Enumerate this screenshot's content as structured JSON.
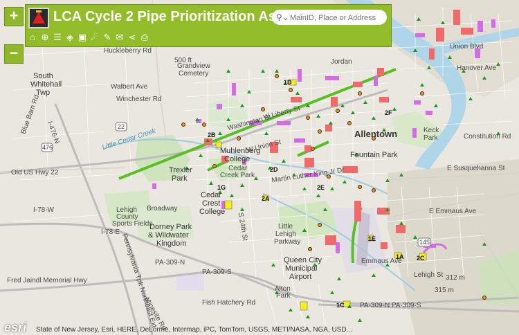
{
  "header": {
    "title": "LCA Cycle 2 Pipe Prioritization Ass...",
    "search_placeholder": "MainID, Place or Address"
  },
  "zoom": {
    "in_label": "+",
    "out_label": "−"
  },
  "toolbar": {
    "icons": [
      "home-icon",
      "locate-icon",
      "legend-icon",
      "layers-icon",
      "basemap-icon",
      "measure-icon",
      "draw-icon",
      "comment-icon",
      "share-icon",
      "print-icon"
    ]
  },
  "map_labels": {
    "huckleberry": "Huckleberry Rd",
    "south_whitehall": "South",
    "south_whitehall2": "Whitehall",
    "south_whitehall3": "Twp",
    "grandview": "Grandview",
    "grandview2": "Cemetery",
    "walbert": "Walbert Ave",
    "winchester": "Winchester Rd",
    "jordan": "Jordan",
    "union_blvd": "Union Blvd",
    "hanover": "Hanover Ave",
    "allentown": "Allentown",
    "fountain_park": "Fountain Park",
    "keck_park": "Keck",
    "keck_park2": "Park",
    "constitution": "Constitution Rd",
    "muhlenberg": "Muhlenberg",
    "muhlenberg2": "College",
    "cedar_creek": "Cedar",
    "cedar_creek2": "Creek Park",
    "trexler": "Trexler",
    "trexler2": "Park",
    "little_cedar": "Little Cedar Creek",
    "blue_barn": "Blue Barn Rd",
    "old_us": "Old US Hwy 22",
    "i476": "I-476-N",
    "i78w": "I-78-W",
    "i78e": "I-78-E",
    "cedar_crest": "Cedar",
    "cedar_crest2": "Crest",
    "cedar_crest3": "College",
    "broadway": "Broadway",
    "lehigh_county": "Lehigh",
    "lehigh_county2": "County",
    "lehigh_county3": "Sports Fields",
    "dorney": "Dorney Park",
    "dorney2": "& Wildwater",
    "dorney3": "Kingdom",
    "little_lehigh": "Little",
    "little_lehigh2": "Lehigh",
    "little_lehigh3": "Parkway",
    "e_susquehanna": "E Susquehanna St",
    "e_emmaus": "E Emmaus Ave",
    "emmaus_ave": "Emmaus Ave",
    "queen_city": "Queen City",
    "queen_city2": "Municipal",
    "queen_city3": "Airport",
    "pa309n": "PA-309-N",
    "pa309s": "PA-309-S",
    "pa309ns": "PA-309-N PA-309-S",
    "fred_jaindl": "Fred Jaindl Memorial Hwy",
    "pennsylvania_tpk": "Pennsylvania Tpk Northeast Ext",
    "fish_hatchery": "Fish Hatchery Rd",
    "minesite": "Minesite Rd",
    "alton_park": "Alton",
    "alton_park2": "Park",
    "s24th": "S 24th St",
    "washington": "Washington St",
    "liberty": "W Liberty St",
    "w_union": "W Union St",
    "martin_luther": "Martin Luther King Jr Dr",
    "lehigh_st": "Lehigh St",
    "elev_500": "500 ft",
    "elev_312": "312 m",
    "elev_315": "315 m",
    "route_22": "22",
    "route_145": "145",
    "route_476": "476",
    "seg_1d": "1D",
    "seg_2d": "2D",
    "seg_1c": "1C",
    "seg_2e": "2E",
    "seg_2c": "2C",
    "seg_1e": "1E",
    "seg_2a": "2A",
    "seg_1a": "1A",
    "seg_2b": "2B",
    "seg_3": "2F",
    "seg_4": "1G"
  },
  "attribution": {
    "logo": "esri",
    "credits": "State of New Jersey, Esri, HERE, DeLorme, Intermap, iPC, TomTom, USGS, METI/NASA, NGA, USD..."
  },
  "colors": {
    "header": "#93bc2b",
    "priority_line": "#55c020",
    "segment_red": "#f06a6a",
    "segment_magenta": "#d46ce8",
    "marker_green": "#1a9c1a",
    "water": "#aed5e8"
  }
}
